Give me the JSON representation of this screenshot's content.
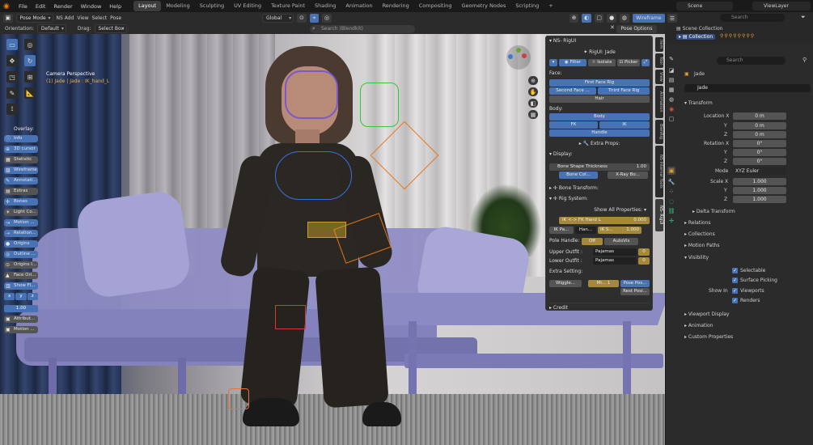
{
  "topbar": {
    "menus": [
      "File",
      "Edit",
      "Render",
      "Window",
      "Help"
    ],
    "workspaces": [
      "Layout",
      "Modeling",
      "Sculpting",
      "UV Editing",
      "Texture Paint",
      "Shading",
      "Animation",
      "Rendering",
      "Compositing",
      "Geometry Nodes",
      "Scripting",
      "+"
    ],
    "scene": "Scene",
    "view_layer": "ViewLayer"
  },
  "viewport_header": {
    "mode": "Pose Mode",
    "addon": "NS Add",
    "menus": [
      "View",
      "Select",
      "Pose"
    ],
    "transform_orientation": "Global",
    "shading": "Wireframe",
    "orientation_label": "Orientation:",
    "orientation_value": "Default",
    "drag_label": "Drag:",
    "drag_value": "Select Box",
    "search_placeholder": "Search (Blendkit)",
    "pose_options": "Pose Options"
  },
  "viewport": {
    "camera_label": "Camera Perspective",
    "object_label": "(1) Jade | Jade : IK_hand_L"
  },
  "overlay_panel": {
    "title": "Overlay:",
    "items": [
      {
        "label": "Info",
        "on": true
      },
      {
        "label": "3D cursor",
        "on": true
      },
      {
        "label": "Statistic",
        "on": false
      },
      {
        "label": "Wireframe",
        "on": true
      },
      {
        "label": "Annotati...",
        "on": true
      },
      {
        "label": "Extras",
        "on": false
      },
      {
        "label": "Bones",
        "on": true
      },
      {
        "label": "Light Co...",
        "on": false
      },
      {
        "label": "Motion ...",
        "on": true
      },
      {
        "label": "Relation...",
        "on": true
      },
      {
        "label": "Origins",
        "on": true
      },
      {
        "label": "Outline ...",
        "on": true
      },
      {
        "label": "Origins I...",
        "on": false
      },
      {
        "label": "Face Ori...",
        "on": false
      },
      {
        "label": "Show Fl...",
        "on": true
      }
    ],
    "axes": [
      "x",
      "y",
      "z"
    ],
    "value": "1.00",
    "bottom": [
      {
        "label": "Attribut...",
        "on": false
      },
      {
        "label": "Motion ...",
        "on": false
      }
    ]
  },
  "rig_panel": {
    "header": "NS- RigUI",
    "rig_title": "RigUI: Jade",
    "filter": "Filter",
    "isolate": "Isolate",
    "picker": "Picker",
    "face_label": "Face:",
    "first_face_rig": "First Face Rig",
    "second_face": "Second Face ...",
    "third_face_rig": "Third Face Rig",
    "hair": "Hair",
    "body_label": "Body:",
    "body": "Body",
    "fk": "FK",
    "ik": "IK",
    "handle": "Handle",
    "extra_props": "Extra Props:",
    "display_label": "Display:",
    "bone_shape_thickness": "Bone Shape Thickness",
    "bone_shape_value": "1.00",
    "bone_col": "Bone Col...",
    "xray": "X-Ray Bo...",
    "bone_transform": "Bone Transform:",
    "rig_system": "Rig System:",
    "show_all_props": "Show All Properties:",
    "ik_fk_hand": "IK <-> FK Hand L",
    "ik_fk_value": "0.000",
    "ik_pa": "IK Pa...",
    "han": "Han...",
    "ik_s": "IK S...",
    "ik_s_value": "1.000",
    "pole_handle": "Pole Handle:",
    "off": "Off",
    "autovis": "AutoVis",
    "upper_outfit": "Upper Outfit :",
    "upper_value": "Pajamas",
    "upper_num": "0",
    "lower_outfit": "Lower Outfit :",
    "lower_value": "Pajamas",
    "lower_num": "0",
    "extra_setting": "Extra Setting:",
    "wiggle": "Wiggle...",
    "mi": "Mi...",
    "mi_value": "1",
    "pose_pos": "Pose Pos...",
    "rest_posi": "Rest Posi...",
    "credit": "Credit"
  },
  "side_tabs": [
    "Item",
    "Tool",
    "View",
    "Animation",
    "BlenRig",
    "NS Internal Tools",
    "NS- RigUI"
  ],
  "outliner": {
    "scene_collection": "Scene Collection",
    "collection": "Collection",
    "search_placeholder": "Search"
  },
  "properties": {
    "search_placeholder": "Search",
    "object_name": "Jade",
    "data_name": "Jade",
    "transform": "Transform",
    "location": {
      "label": "Location X",
      "x": "0 m",
      "y": "0 m",
      "z": "0 m"
    },
    "rotation": {
      "label": "Rotation X",
      "x": "0°",
      "y": "0°",
      "z": "0°"
    },
    "mode_label": "Mode",
    "mode_value": "XYZ Euler",
    "scale": {
      "label": "Scale X",
      "x": "1.000",
      "y": "1.000",
      "z": "1.000"
    },
    "axis_y": "Y",
    "axis_z": "Z",
    "delta_transform": "Delta Transform",
    "relations": "Relations",
    "collections": "Collections",
    "motion_paths": "Motion Paths",
    "visibility": "Visibility",
    "selectable": "Selectable",
    "surface_picking": "Surface Picking",
    "show_in": "Show In",
    "viewports": "Viewports",
    "renders": "Renders",
    "viewport_display": "Viewport Display",
    "animation": "Animation",
    "custom_properties": "Custom Properties"
  }
}
